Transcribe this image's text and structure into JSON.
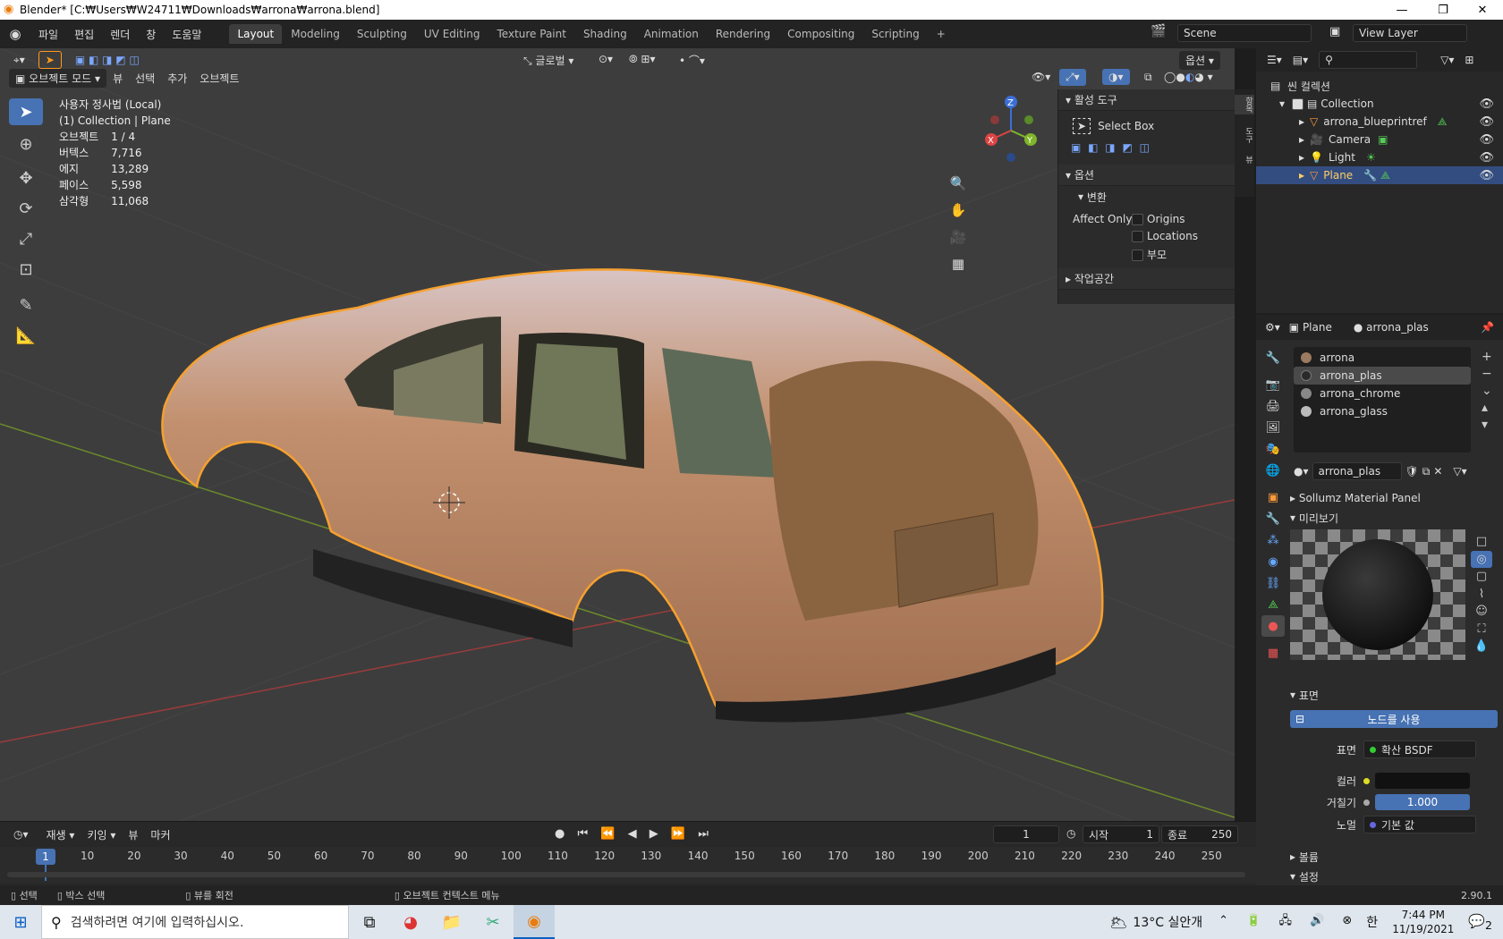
{
  "window": {
    "title": "Blender* [C:₩Users₩W24711₩Downloads₩arrona₩arrona.blend]",
    "min": "—",
    "max": "❐",
    "close": "✕"
  },
  "menu": [
    "파일",
    "편집",
    "렌더",
    "창",
    "도움말"
  ],
  "workspaces": [
    "Layout",
    "Modeling",
    "Sculpting",
    "UV Editing",
    "Texture Paint",
    "Shading",
    "Animation",
    "Rendering",
    "Compositing",
    "Scripting"
  ],
  "active_workspace": "Layout",
  "scene": {
    "name": "Scene",
    "view_layer": "View Layer"
  },
  "viewport": {
    "mode": "오브젝트 모드",
    "header_menus": [
      "뷰",
      "선택",
      "추가",
      "오브젝트"
    ],
    "transform_orientation": "글로벌",
    "options_label": "옵션",
    "view_name": "사용자 정사법 (Local)",
    "collection_path": "(1) Collection | Plane",
    "stats": [
      {
        "label": "오브젝트",
        "value": "1 / 4"
      },
      {
        "label": "버텍스",
        "value": "7,716"
      },
      {
        "label": "에지",
        "value": "13,289"
      },
      {
        "label": "페이스",
        "value": "5,598"
      },
      {
        "label": "삼각형",
        "value": "11,068"
      }
    ],
    "gizmo": {
      "x": "X",
      "y": "Y",
      "z": "Z"
    }
  },
  "npanel": {
    "active_tool_header": "활성 도구",
    "tool_name": "Select Box",
    "options_header": "옵션",
    "transform_header": "변환",
    "affect_only": "Affect Only",
    "checks": [
      "Origins",
      "Locations",
      "부모"
    ],
    "workspace_header": "작업공간",
    "tabs": [
      "항목",
      "도구",
      "뷰"
    ]
  },
  "outliner": {
    "root": "씬 컬렉션",
    "collection": "Collection",
    "items": [
      {
        "name": "arrona_blueprintref"
      },
      {
        "name": "Camera"
      },
      {
        "name": "Light"
      },
      {
        "name": "Plane"
      }
    ],
    "selected": "Plane"
  },
  "properties": {
    "object": "Plane",
    "material": "arrona_plas",
    "slots": [
      {
        "name": "arrona",
        "color": "#9a7a60"
      },
      {
        "name": "arrona_plas",
        "color": "#2a2a2a"
      },
      {
        "name": "arrona_chrome",
        "color": "#888888"
      },
      {
        "name": "arrona_glass",
        "color": "#bbbbbb"
      }
    ],
    "selected_slot": "arrona_plas",
    "material_field": "arrona_plas",
    "sollumz": "Sollumz Material Panel",
    "preview": "미리보기",
    "surface": "표면",
    "use_nodes": "노드를 사용",
    "surface_label": "표면",
    "surface_value": "확산 BSDF",
    "color_label": "컬러",
    "roughness_label": "거칠기",
    "roughness_value": "1.000",
    "normal_label": "노멀",
    "normal_value": "기본 값",
    "volume": "볼륨",
    "settings": "설정"
  },
  "timeline": {
    "menus": [
      "재생",
      "키잉",
      "뷰",
      "마커"
    ],
    "current_frame": "1",
    "start_label": "시작",
    "start": "1",
    "end_label": "종료",
    "end": "250",
    "ticks": [
      "10",
      "20",
      "30",
      "40",
      "50",
      "60",
      "70",
      "80",
      "90",
      "100",
      "110",
      "120",
      "130",
      "140",
      "150",
      "160",
      "170",
      "180",
      "190",
      "200",
      "210",
      "220",
      "230",
      "240",
      "250"
    ]
  },
  "status": {
    "select": "선택",
    "box_select": "박스 선택",
    "rotate": "뷰를 회전",
    "context": "오브젝트 컨텍스트 메뉴",
    "version": "2.90.1"
  },
  "taskbar": {
    "search": "검색하려면 여기에 입력하십시오.",
    "weather": "13°C  실안개",
    "ime": "한",
    "time": "7:44 PM",
    "date": "11/19/2021",
    "notif": "2"
  }
}
